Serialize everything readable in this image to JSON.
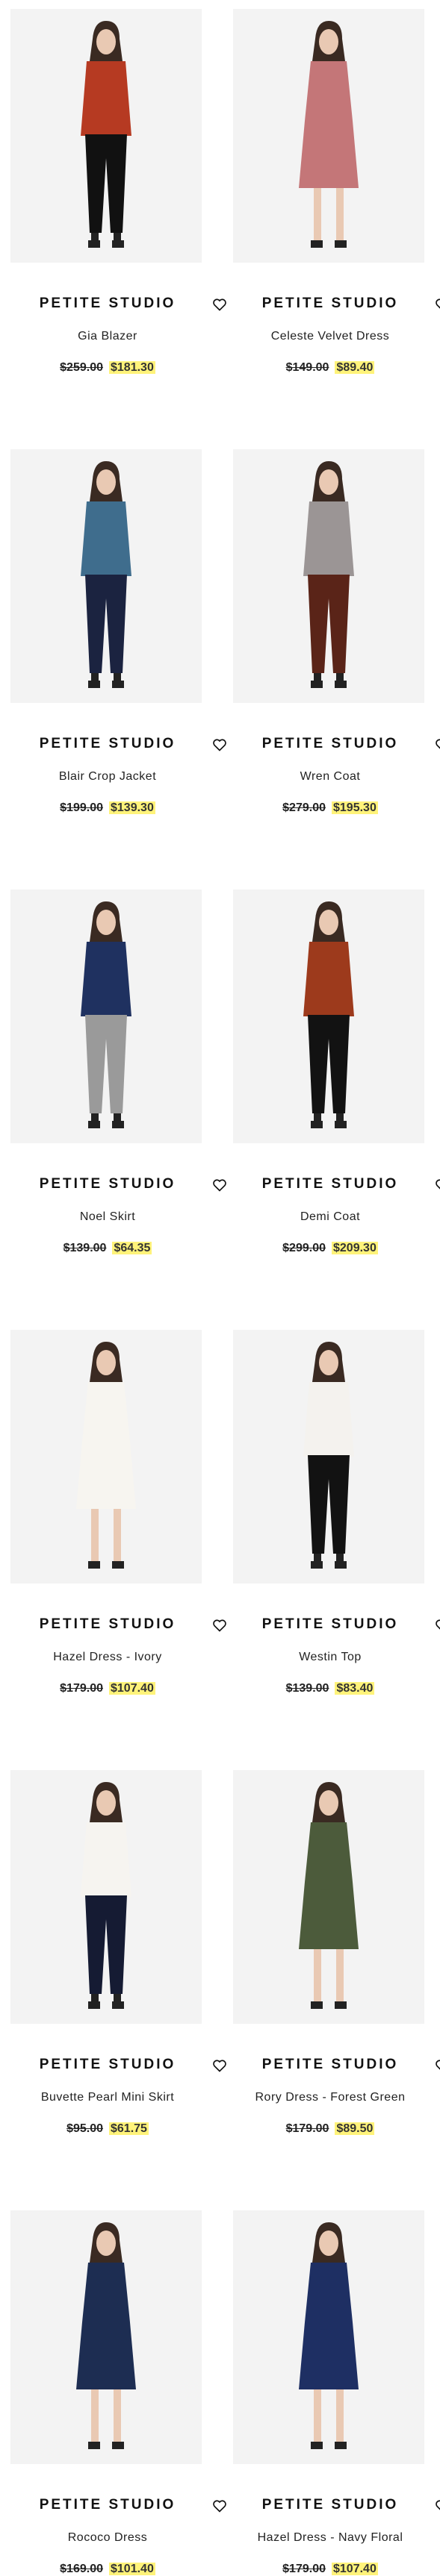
{
  "products": [
    {
      "brand": "PETITE STUDIO",
      "name": "Gia Blazer",
      "original_price": "$259.00",
      "sale_price": "$181.30",
      "colors": {
        "top": "#b63a22",
        "bottom": "#111111",
        "bg": "#f3f3f3"
      }
    },
    {
      "brand": "PETITE STUDIO",
      "name": "Celeste Velvet Dress",
      "original_price": "$149.00",
      "sale_price": "$89.40",
      "colors": {
        "top": "#c47678",
        "bottom": "#c47678",
        "bg": "#f3f3f3"
      }
    },
    {
      "brand": "PETITE STUDIO",
      "name": "Blair Crop Jacket",
      "original_price": "$199.00",
      "sale_price": "$139.30",
      "colors": {
        "top": "#3f6d8d",
        "bottom": "#1b2340",
        "bg": "#f3f3f3"
      }
    },
    {
      "brand": "PETITE STUDIO",
      "name": "Wren Coat",
      "original_price": "$279.00",
      "sale_price": "$195.30",
      "colors": {
        "top": "#9b9595",
        "bottom": "#5a2418",
        "bg": "#f3f3f3"
      }
    },
    {
      "brand": "PETITE STUDIO",
      "name": "Noel Skirt",
      "original_price": "$139.00",
      "sale_price": "$64.35",
      "colors": {
        "top": "#1f3160",
        "bottom": "#9a9a9a",
        "bg": "#f3f3f3"
      }
    },
    {
      "brand": "PETITE STUDIO",
      "name": "Demi Coat",
      "original_price": "$299.00",
      "sale_price": "$209.30",
      "colors": {
        "top": "#9d3a1c",
        "bottom": "#121212",
        "bg": "#f3f3f3"
      }
    },
    {
      "brand": "PETITE STUDIO",
      "name": "Hazel Dress - Ivory",
      "original_price": "$179.00",
      "sale_price": "$107.40",
      "colors": {
        "top": "#f7f5f0",
        "bottom": "#f7f5f0",
        "bg": "#f3f3f3"
      }
    },
    {
      "brand": "PETITE STUDIO",
      "name": "Westin Top",
      "original_price": "$139.00",
      "sale_price": "$83.40",
      "colors": {
        "top": "#f4f2ee",
        "bottom": "#121212",
        "bg": "#f3f3f3"
      }
    },
    {
      "brand": "PETITE STUDIO",
      "name": "Buvette Pearl Mini Skirt",
      "original_price": "$95.00",
      "sale_price": "$61.75",
      "colors": {
        "top": "#f6f4f0",
        "bottom": "#151b33",
        "bg": "#f3f3f3"
      }
    },
    {
      "brand": "PETITE STUDIO",
      "name": "Rory Dress - Forest Green",
      "original_price": "$179.00",
      "sale_price": "$89.50",
      "colors": {
        "top": "#4c5b3b",
        "bottom": "#4c5b3b",
        "bg": "#f3f3f3"
      }
    },
    {
      "brand": "PETITE STUDIO",
      "name": "Rococo Dress",
      "original_price": "$169.00",
      "sale_price": "$101.40",
      "colors": {
        "top": "#1d2d52",
        "bottom": "#1d2d52",
        "bg": "#f3f3f3"
      }
    },
    {
      "brand": "PETITE STUDIO",
      "name": "Hazel Dress - Navy Floral",
      "original_price": "$179.00",
      "sale_price": "$107.40",
      "colors": {
        "top": "#1e2f63",
        "bottom": "#1e2f63",
        "bg": "#f3f3f3"
      }
    }
  ],
  "icons": {
    "wishlist": "heart-outline-icon"
  },
  "accent_highlight": "#fff37a"
}
